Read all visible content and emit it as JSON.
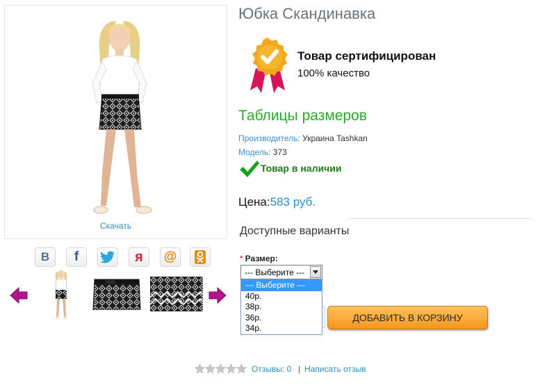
{
  "product": {
    "title": "Юбка Скандинавка",
    "download_label": "Скачать",
    "certificate_title": "Товар сертифицирован",
    "certificate_subtitle": "100% качество",
    "size_table_link": "Таблицы размеров",
    "manufacturer_label": "Производитель:",
    "manufacturer_value": "Украина Tashkan",
    "model_label": "Модель:",
    "model_value": "373",
    "stock_status": "Товар в наличии",
    "price_label": "Цена:",
    "price_value": "583 руб."
  },
  "share": {
    "items": [
      {
        "icon": "vkontakte-icon",
        "glyph": "B",
        "color": "#4b6f96"
      },
      {
        "icon": "facebook-icon",
        "glyph": "f",
        "color": "#3b5998"
      },
      {
        "icon": "twitter-icon",
        "glyph": "",
        "color": "#2ea5dc"
      },
      {
        "icon": "yaru-icon",
        "glyph": "я",
        "color": "#d8232a"
      },
      {
        "icon": "mailru-icon",
        "glyph": "@",
        "color": "#f07d00"
      },
      {
        "icon": "odnoklassniki-icon",
        "glyph": "",
        "color": "#f08a00"
      }
    ]
  },
  "options": {
    "section_title": "Доступные варианты",
    "required_mark": "*",
    "size_label": "Размер:",
    "size_selected": "--- Выберите ---",
    "size_options": [
      "--- Выберите ---",
      "40р.",
      "38р.",
      "36р.",
      "34р."
    ]
  },
  "cart": {
    "button_label": "ДОБАВИТЬ В КОРЗИНУ"
  },
  "reviews": {
    "rating": 0,
    "reviews_link": "Отзывы: 0",
    "separator": "|",
    "write_review": "Написать отзыв"
  },
  "colors": {
    "accent_blue": "#2a8fc4",
    "green_link": "#2aaa2a",
    "button_orange": "#f7961f",
    "badge_gold": "#f3a81b",
    "ribbon_red": "#d6145a"
  }
}
